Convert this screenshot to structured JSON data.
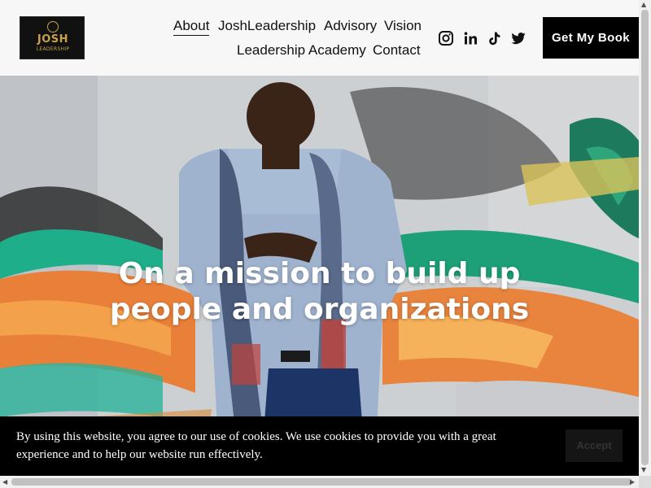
{
  "header": {
    "logo": {
      "line1": "JOSH",
      "line2": "LEADERSHIP"
    },
    "nav": [
      {
        "label": "About",
        "active": true
      },
      {
        "label": "JoshLeadership"
      },
      {
        "label": "Advisory"
      },
      {
        "label": "Vision"
      },
      {
        "label": "Leadership Academy"
      },
      {
        "label": "Contact"
      }
    ],
    "social": [
      "instagram-icon",
      "linkedin-icon",
      "tiktok-icon",
      "twitter-icon"
    ],
    "cta_label": "Get My Book"
  },
  "hero": {
    "title_line1": "On a mission to build up",
    "title_line2": "people and organizations"
  },
  "cookie": {
    "text": "By using this website, you agree to our use of cookies. We use cookies to provide you with a great experience and to help our website run effectively.",
    "accept_label": "Accept"
  },
  "colors": {
    "header_bg": "#f7f7f7",
    "cta_bg": "#000000",
    "cookie_bg": "#000000",
    "hero_text": "#ffffff"
  }
}
